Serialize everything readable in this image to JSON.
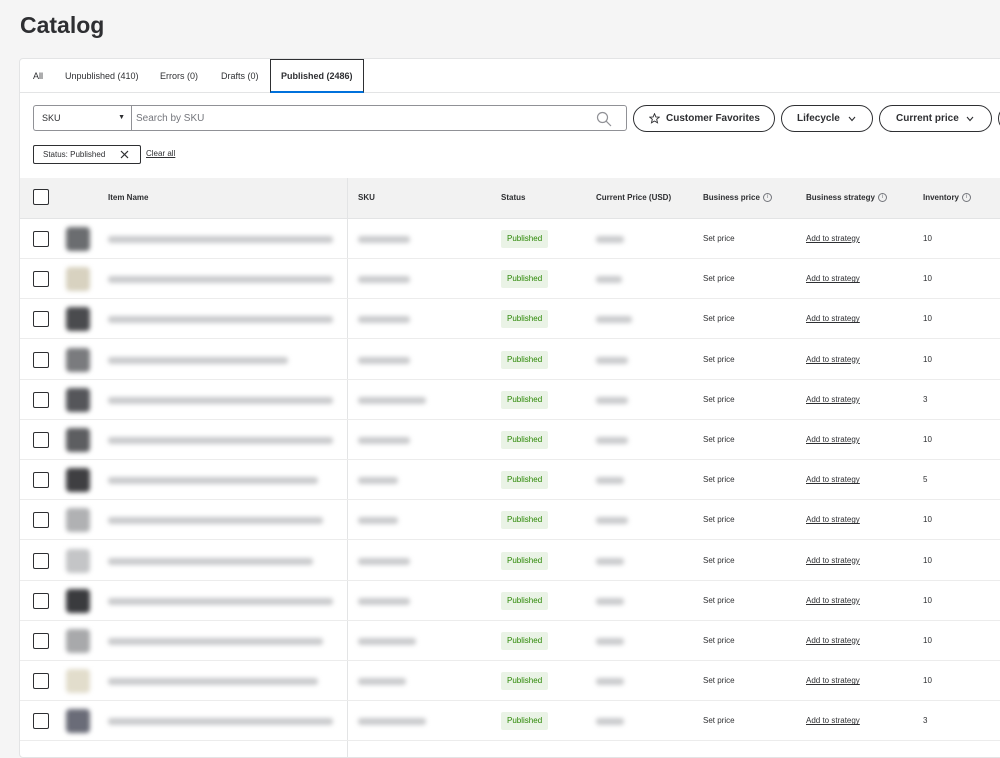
{
  "page": {
    "title": "Catalog"
  },
  "tabs": [
    {
      "label": "All"
    },
    {
      "label": "Unpublished (410)"
    },
    {
      "label": "Errors (0)"
    },
    {
      "label": "Drafts (0)"
    },
    {
      "label": "Published (2486)",
      "active": true
    }
  ],
  "search": {
    "field_select": "SKU",
    "placeholder": "Search by SKU",
    "value": ""
  },
  "filter_pills": [
    {
      "label": "Customer Favorites",
      "icon": "star-icon"
    },
    {
      "label": "Lifecycle",
      "icon": "chevron-down-icon"
    },
    {
      "label": "Current price",
      "icon": "chevron-down-icon"
    }
  ],
  "applied_filter": {
    "label": "Status: Published"
  },
  "clear_all_label": "Clear all",
  "table": {
    "columns": [
      "Item Name",
      "SKU",
      "Status",
      "Current Price (USD)",
      "Business price",
      "Business strategy",
      "Inventory"
    ],
    "rows": [
      {
        "status": "Published",
        "business_price": "Set price",
        "strategy": "Add to strategy",
        "inventory": "10"
      },
      {
        "status": "Published",
        "business_price": "Set price",
        "strategy": "Add to strategy",
        "inventory": "10"
      },
      {
        "status": "Published",
        "business_price": "Set price",
        "strategy": "Add to strategy",
        "inventory": "10"
      },
      {
        "status": "Published",
        "business_price": "Set price",
        "strategy": "Add to strategy",
        "inventory": "10"
      },
      {
        "status": "Published",
        "business_price": "Set price",
        "strategy": "Add to strategy",
        "inventory": "3"
      },
      {
        "status": "Published",
        "business_price": "Set price",
        "strategy": "Add to strategy",
        "inventory": "10"
      },
      {
        "status": "Published",
        "business_price": "Set price",
        "strategy": "Add to strategy",
        "inventory": "5"
      },
      {
        "status": "Published",
        "business_price": "Set price",
        "strategy": "Add to strategy",
        "inventory": "10"
      },
      {
        "status": "Published",
        "business_price": "Set price",
        "strategy": "Add to strategy",
        "inventory": "10"
      },
      {
        "status": "Published",
        "business_price": "Set price",
        "strategy": "Add to strategy",
        "inventory": "10"
      },
      {
        "status": "Published",
        "business_price": "Set price",
        "strategy": "Add to strategy",
        "inventory": "10"
      },
      {
        "status": "Published",
        "business_price": "Set price",
        "strategy": "Add to strategy",
        "inventory": "10"
      },
      {
        "status": "Published",
        "business_price": "Set price",
        "strategy": "Add to strategy",
        "inventory": "3"
      }
    ]
  },
  "colors": {
    "accent": "#0071dc",
    "published_text": "#2a8703",
    "published_bg": "#eaf3e6",
    "text": "#2e2f32"
  }
}
